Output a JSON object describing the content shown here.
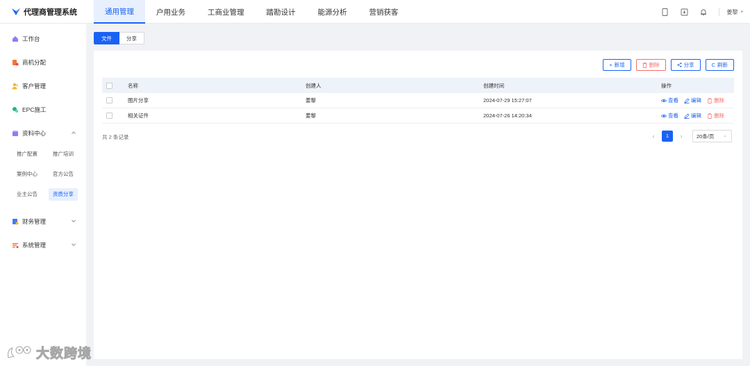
{
  "app": {
    "title": "代理商管理系统"
  },
  "topnav": {
    "items": [
      "通用管理",
      "户用业务",
      "工商业管理",
      "踏勘设计",
      "能源分析",
      "营销获客"
    ],
    "active_index": 0
  },
  "user": {
    "name": "姜黎"
  },
  "sidebar": {
    "items": [
      {
        "label": "工作台",
        "icon": "home-icon"
      },
      {
        "label": "商机分配",
        "icon": "opportunity-icon"
      },
      {
        "label": "客户管理",
        "icon": "customer-icon"
      },
      {
        "label": "EPC施工",
        "icon": "construction-icon"
      },
      {
        "label": "资料中心",
        "icon": "folder-icon",
        "expanded": true
      },
      {
        "label": "财务管理",
        "icon": "finance-icon"
      },
      {
        "label": "系统管理",
        "icon": "settings-icon"
      }
    ],
    "subitems": [
      "推广配置",
      "推广培训",
      "案例中心",
      "官方公告",
      "业主公告",
      "资质分享"
    ],
    "active_sub": "资质分享"
  },
  "tabs": [
    "文件",
    "分享"
  ],
  "toolbar": {
    "add": "新增",
    "delete": "删除",
    "share": "分享",
    "refresh": "刷新"
  },
  "table": {
    "columns": [
      "名称",
      "创建人",
      "创建时间",
      "操作"
    ],
    "rows": [
      {
        "name": "图片分享",
        "creator": "姜黎",
        "created": "2024-07-29 15:27:07"
      },
      {
        "name": "相关证件",
        "creator": "姜黎",
        "created": "2024-07-26 14:20:34"
      }
    ],
    "actions": {
      "view": "查看",
      "edit": "编辑",
      "delete": "删除"
    }
  },
  "pagination": {
    "total": "共 2 条记录",
    "current": "1",
    "page_size": "20条/页"
  },
  "watermark": "大数跨境",
  "colors": {
    "primary": "#1a62f5",
    "danger": "#f56c6c"
  }
}
